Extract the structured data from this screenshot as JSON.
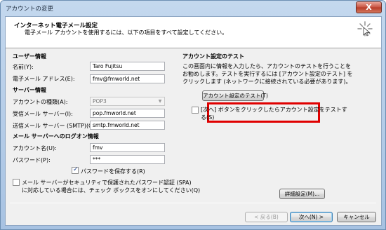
{
  "window": {
    "title": "アカウントの変更",
    "close": "X"
  },
  "header": {
    "title": "インターネット電子メール設定",
    "description": "電子メール アカウントを使用するには、以下の項目をすべて設定してください。"
  },
  "user_info": {
    "section": "ユーザー情報",
    "name_label": "名前(Y):",
    "name_value": "Taro Fujitsu",
    "email_label": "電子メール アドレス(E):",
    "email_value": "fmv@fmworld.net"
  },
  "server_info": {
    "section": "サーバー情報",
    "account_type_label": "アカウントの種類(A):",
    "account_type_value": "POP3",
    "incoming_label": "受信メール サーバー(I):",
    "incoming_value": "pop.fmworld.net",
    "outgoing_label": "送信メール サーバー (SMTP)(O):",
    "outgoing_value": "smtp.fmworld.net"
  },
  "logon_info": {
    "section": "メール サーバーへのログオン情報",
    "account_label": "アカウント名(U):",
    "account_value": "fmv",
    "password_label": "パスワード(P):",
    "password_value": "***",
    "remember_password": "パスワードを保存する(R)",
    "spa_line1": "メール サーバーがセキュリティで保護されたパスワード認証 (SPA)",
    "spa_line2": "に対応している場合には、チェック ボックスをオンにしてください(Q)"
  },
  "test": {
    "section": "アカウント設定のテスト",
    "desc_line1": "この画面内に情報を入力したら、アカウントのテストを行うことを",
    "desc_line2": "お勧めします。テストを実行するには [アカウント設定のテスト] を",
    "desc_line3": "クリックします (ネットワークに接続されている必要があります)。",
    "test_button": "アカウント設定のテスト(T)",
    "auto_test_line1": "[次へ] ボタンをクリックしたらアカウント設定をテストす",
    "auto_test_line2": "る(S)"
  },
  "buttons": {
    "advanced": "詳細設定(M)...",
    "back": "< 戻る(B)",
    "next": "次へ(N) >",
    "cancel": "キャンセル"
  },
  "colors": {
    "highlight": "#e00000",
    "title_bar": "#a7c2e2"
  }
}
